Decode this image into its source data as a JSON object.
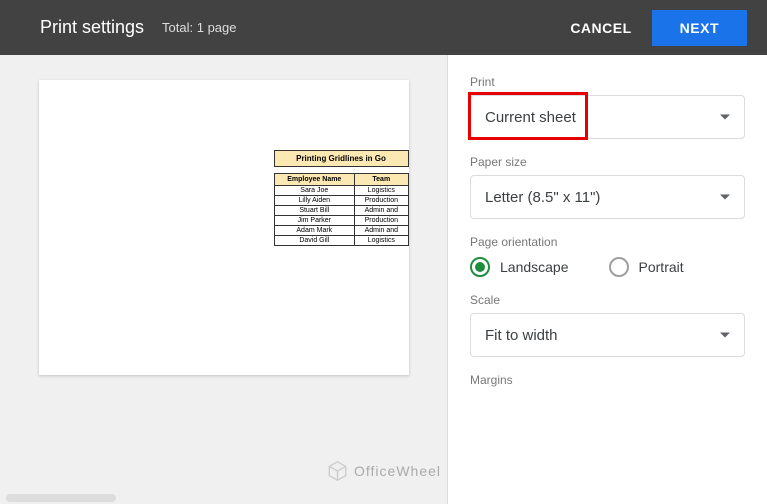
{
  "header": {
    "title": "Print settings",
    "subtitle": "Total: 1 page",
    "cancel": "CANCEL",
    "next": "NEXT"
  },
  "preview": {
    "sheet_title": "Printing Gridlines in Go",
    "columns": [
      "Employee Name",
      "Team"
    ],
    "rows": [
      [
        "Sara Joe",
        "Logistics"
      ],
      [
        "Lilly Aiden",
        "Production"
      ],
      [
        "Stuart Bill",
        "Admin and"
      ],
      [
        "Jim Parker",
        "Production"
      ],
      [
        "Adam Mark",
        "Admin and"
      ],
      [
        "David Gill",
        "Logistics"
      ]
    ]
  },
  "sidebar": {
    "print_label": "Print",
    "print_value": "Current sheet",
    "paper_label": "Paper size",
    "paper_value": "Letter (8.5\" x 11\")",
    "orientation_label": "Page orientation",
    "orientation_landscape": "Landscape",
    "orientation_portrait": "Portrait",
    "scale_label": "Scale",
    "scale_value": "Fit to width",
    "margins_label": "Margins"
  },
  "watermark": "OfficeWheel"
}
